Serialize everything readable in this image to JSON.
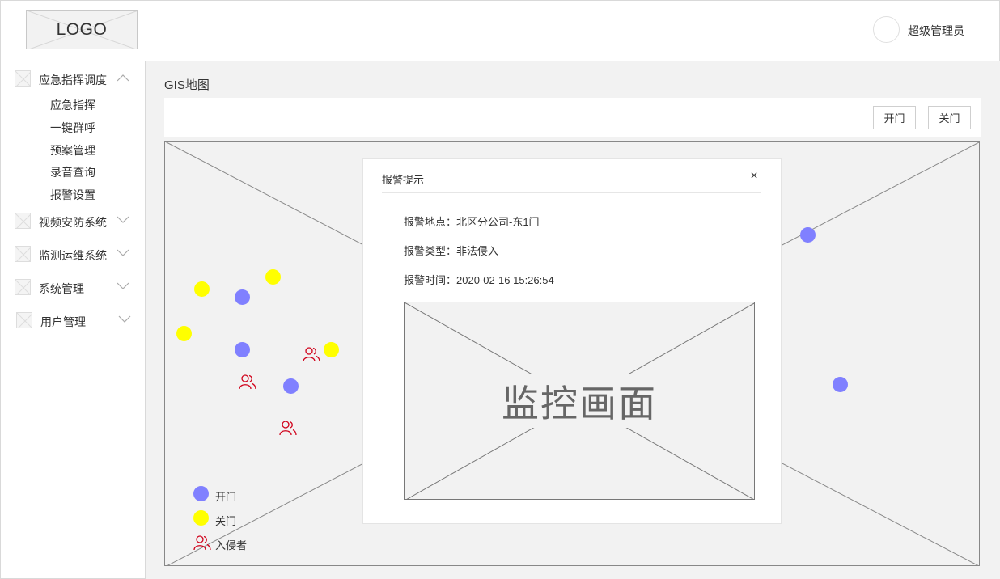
{
  "header": {
    "logo_text": "LOGO",
    "user_name": "超级管理员"
  },
  "sidebar": {
    "groups": [
      {
        "label": "应急指挥调度",
        "expanded": true,
        "children": [
          "应急指挥",
          "一键群呼",
          "预案管理",
          "录音查询",
          "报警设置"
        ]
      },
      {
        "label": "视频安防系统",
        "expanded": false
      },
      {
        "label": "监测运维系统",
        "expanded": false
      },
      {
        "label": "系统管理",
        "expanded": false
      },
      {
        "label": "用户管理",
        "expanded": false
      }
    ]
  },
  "main": {
    "title": "GIS地图",
    "toolbar": {
      "open_label": "开门",
      "close_label": "关门"
    }
  },
  "map": {
    "colors": {
      "open": "#8080ff",
      "close": "#ffff00",
      "intruder": "#d0021b"
    },
    "legend": {
      "open": "开门",
      "close": "关门",
      "intruder": "入侵者"
    }
  },
  "dialog": {
    "title": "报警提示",
    "close_icon": "×",
    "location": "报警地点：北区分公司-东1门",
    "type": "报警类型：非法侵入",
    "time": "报警时间：2020-02-16 15:26:54",
    "feed_label": "监控画面"
  }
}
